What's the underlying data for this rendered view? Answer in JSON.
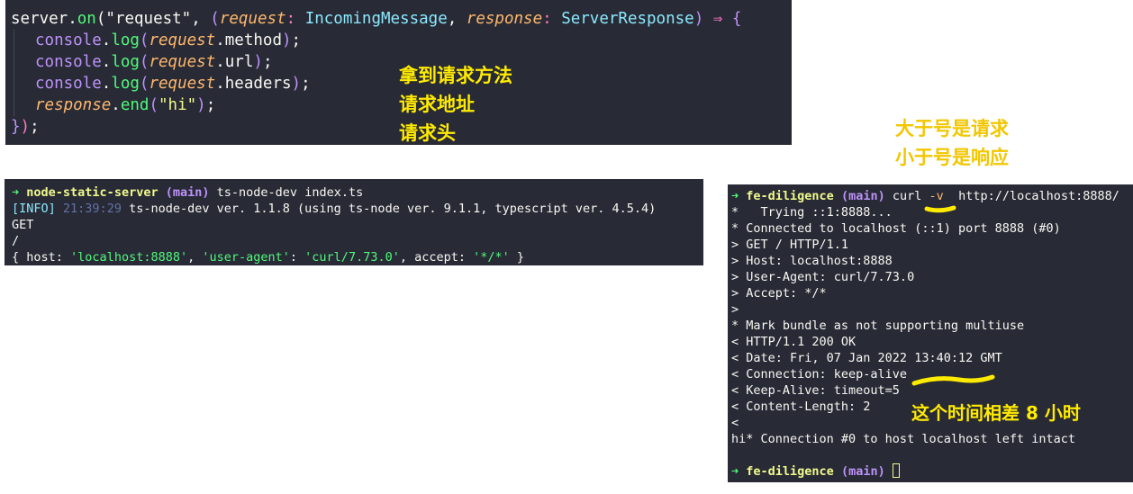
{
  "code": {
    "line1": {
      "obj": "server",
      "dot": ".",
      "method": "on",
      "open": "(",
      "event": "\"request\"",
      "comma": ", ",
      "paren": "(",
      "p1": "request",
      "colon1": ": ",
      "t1": "IncomingMessage",
      "comma2": ", ",
      "p2": "response",
      "colon2": ": ",
      "t2": "ServerResponse",
      "close": ")",
      "arrow": " ⇒ ",
      "brace": "{"
    },
    "line2": {
      "obj": "console",
      "dot": ".",
      "method": "log",
      "open": "(",
      "arg": "request",
      "prop": ".method",
      "close": ")",
      "end": ";"
    },
    "line3": {
      "obj": "console",
      "dot": ".",
      "method": "log",
      "open": "(",
      "arg": "request",
      "prop": ".url",
      "close": ")",
      "end": ";"
    },
    "line4": {
      "obj": "console",
      "dot": ".",
      "method": "log",
      "open": "(",
      "arg": "request",
      "prop": ".headers",
      "close": ")",
      "end": ";"
    },
    "line5": {
      "arg": "response",
      "dot": ".",
      "method": "end",
      "open": "(",
      "str": "\"hi\"",
      "close": ")",
      "end": ";"
    },
    "line6": {
      "brace": "}",
      "close": ")",
      "end": ";"
    }
  },
  "annotations": {
    "code_notes": [
      "拿到请求方法",
      "请求地址",
      "请求头"
    ],
    "symbol_notes": [
      "大于号是请求",
      "小于号是响应"
    ],
    "time_note": "这个时间相差 8 小时"
  },
  "terminal_left": {
    "prompt_arrow": "➜",
    "dir": "node-static-server",
    "branch": "(main)",
    "command": "ts-node-dev index.ts",
    "info_tag": "[INFO]",
    "info_time": "21:39:29",
    "info_text": "ts-node-dev ver. 1.1.8 (using ts-node ver. 9.1.1, typescript ver. 4.5.4)",
    "method_out": "GET",
    "url_out": "/",
    "headers_open": "{ ",
    "host_key": "host: ",
    "host_val": "'localhost:8888'",
    "sep1": ", ",
    "ua_key": "'user-agent'",
    "ua_colon": ": ",
    "ua_val": "'curl/7.73.0'",
    "sep2": ", ",
    "accept_key": "accept: ",
    "accept_val": "'*/*'",
    "headers_close": " }"
  },
  "terminal_right": {
    "prompt_arrow": "➜",
    "dir": "fe-diligence",
    "branch": "(main)",
    "cmd": "curl",
    "flag": "-v",
    "url": "http://localhost:8888/",
    "lines": [
      "*   Trying ::1:8888...",
      "* Connected to localhost (::1) port 8888 (#0)",
      "> GET / HTTP/1.1",
      "> Host: localhost:8888",
      "> User-Agent: curl/7.73.0",
      "> Accept: */*",
      ">",
      "* Mark bundle as not supporting multiuse",
      "< HTTP/1.1 200 OK",
      "< Date: Fri, 07 Jan 2022 13:40:12 GMT",
      "< Connection: keep-alive",
      "< Keep-Alive: timeout=5",
      "< Content-Length: 2",
      "<",
      "hi* Connection #0 to host localhost left intact",
      ""
    ],
    "prompt2_arrow": "➜",
    "prompt2_dir": "fe-diligence",
    "prompt2_branch": "(main)"
  },
  "colors": {
    "editor_bg": "#282a36",
    "annotation": "#ffeb00",
    "prompt_green": "#50fa7b",
    "dir_yellow": "#f1fa8c",
    "branch_purple": "#bd93f9"
  }
}
